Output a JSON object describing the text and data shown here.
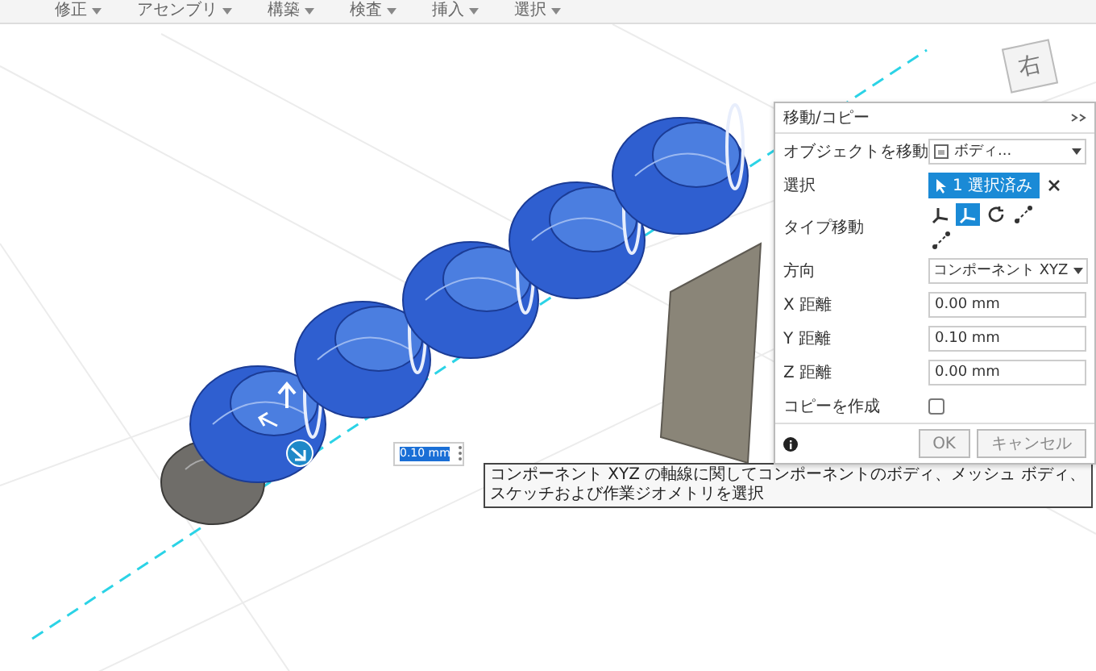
{
  "menu": [
    "修正",
    "アセンブリ",
    "構築",
    "検査",
    "挿入",
    "選択"
  ],
  "view_cube": {
    "face": "右"
  },
  "value_input": {
    "value": "0.10 mm"
  },
  "tooltip": "コンポーネント XYZ の軸線に関してコンポーネントのボディ、メッシュ ボディ、スケッチおよび作業ジオメトリを選択",
  "panel": {
    "title": "移動/コピー",
    "rows": [
      {
        "kind": "object",
        "label": "オブジェクトを移動",
        "value": "ボディ..."
      },
      {
        "kind": "selection",
        "label": "選択",
        "value": "1 選択済み"
      },
      {
        "kind": "types",
        "label": "タイプ移動",
        "options": [
          {
            "selected": false
          },
          {
            "selected": true
          },
          {
            "selected": false
          },
          {
            "selected": false
          },
          {
            "selected": false
          }
        ]
      },
      {
        "kind": "dropdown",
        "label": "方向",
        "value": "コンポーネント XYZ"
      },
      {
        "kind": "input",
        "label": "X 距離",
        "value": "0.00 mm"
      },
      {
        "kind": "input",
        "label": "Y 距離",
        "value": "0.10 mm"
      },
      {
        "kind": "input",
        "label": "Z 距離",
        "value": "0.00 mm"
      },
      {
        "kind": "checkbox",
        "label": "コピーを作成",
        "checked": false
      }
    ],
    "buttons": [
      "OK",
      "キャンセル"
    ]
  }
}
